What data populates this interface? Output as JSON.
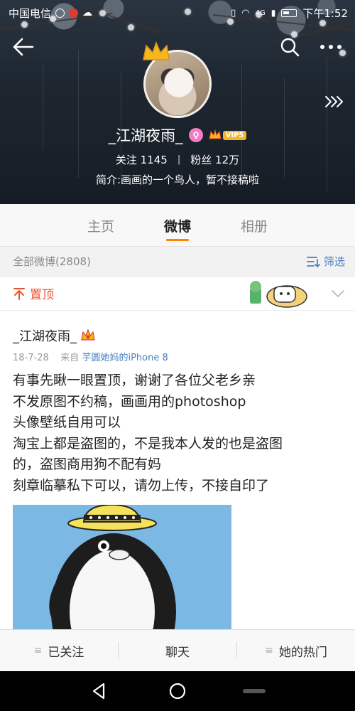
{
  "status_bar": {
    "carrier": "中国电信",
    "network": "4G",
    "time": "下午1:52"
  },
  "header": {
    "back_icon": "back-arrow-icon",
    "search_icon": "search-icon",
    "more_icon": "more-dots-icon",
    "expand_icon": "triple-chevron-right-icon"
  },
  "profile": {
    "name": "_江湖夜雨_",
    "vip_label": "VIP5",
    "following_label": "关注",
    "following_count": "1145",
    "followers_label": "粉丝",
    "followers_count": "12万",
    "separator": "|",
    "bio": "简介:画画的一个鸟人，暂不接稿啦"
  },
  "tabs": [
    {
      "label": "主页",
      "active": false
    },
    {
      "label": "微博",
      "active": true
    },
    {
      "label": "相册",
      "active": false
    }
  ],
  "feed": {
    "header_label": "全部微博(2808)",
    "filter_label": "筛选",
    "pinned_label": "置顶"
  },
  "post": {
    "author": "_江湖夜雨_",
    "date": "18-7-28",
    "source_prefix": "来自",
    "source": "芋圆她妈的iPhone 8",
    "lines": [
      "有事先瞅一眼置顶，谢谢了各位父老乡亲",
      "不发原图不约稿，画画用的photoshop",
      "头像壁纸自用可以",
      "淘宝上都是盗图的，不是我本人发的也是盗图",
      "的，盗图商用狗不配有妈",
      "刻章临摹私下可以，请勿上传，不接自印了"
    ]
  },
  "actions": [
    {
      "label": "已关注",
      "icon": "menu-lines-icon"
    },
    {
      "label": "聊天",
      "icon": ""
    },
    {
      "label": "她的热门",
      "icon": "menu-lines-icon"
    }
  ],
  "colors": {
    "accent_orange": "#ff8200",
    "pinned_red": "#e8542f",
    "link_blue": "#4a7fbf",
    "vip_gold": "#f3b52a"
  }
}
